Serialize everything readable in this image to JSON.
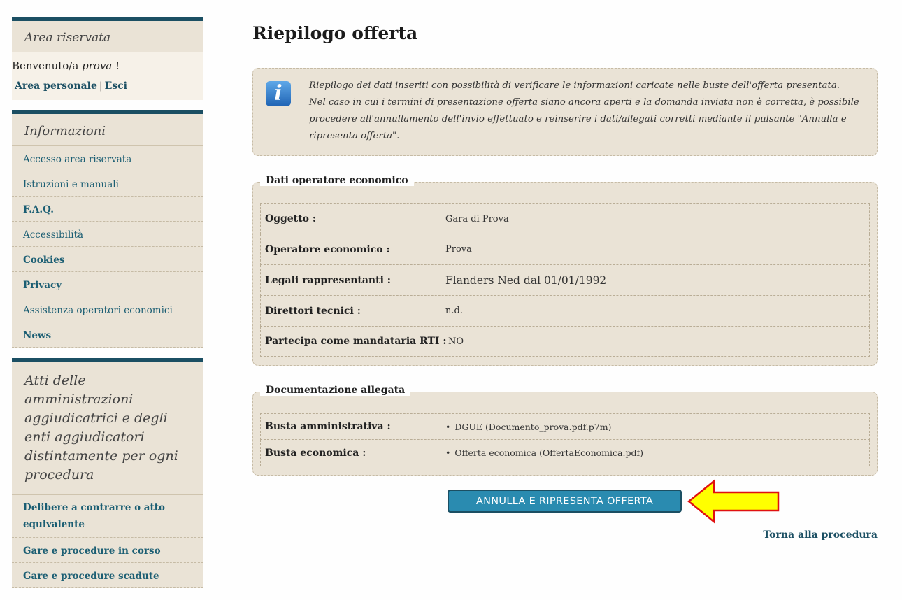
{
  "sidebar": {
    "reserved": {
      "title": "Area riservata",
      "welcome_prefix": "Benvenuto/a ",
      "username": "prova",
      "welcome_suffix": " !",
      "personal_area": "Area personale",
      "separator": "|",
      "logout": "Esci"
    },
    "info": {
      "title": "Informazioni",
      "items": [
        {
          "label": "Accesso area riservata"
        },
        {
          "label": "Istruzioni e manuali"
        },
        {
          "label": "F.A.Q."
        },
        {
          "label": "Accessibilità"
        },
        {
          "label": "Cookies"
        },
        {
          "label": "Privacy"
        },
        {
          "label": "Assistenza operatori economici"
        },
        {
          "label": "News"
        }
      ]
    },
    "acts": {
      "title": "Atti delle amministrazioni aggiudicatrici e degli enti aggiudicatori distintamente per ogni procedura",
      "items": [
        {
          "label": "Delibere a contrarre o atto equivalente"
        },
        {
          "label": "Gare e procedure in corso"
        },
        {
          "label": "Gare e procedure scadute"
        }
      ]
    }
  },
  "main": {
    "title": "Riepilogo offerta",
    "info_line1": "Riepilogo dei dati inseriti con possibilità di verificare le informazioni caricate nelle buste dell'offerta presentata.",
    "info_line2": "Nel caso in cui i termini di presentazione offerta siano ancora aperti e la domanda inviata non è corretta, è possibile procedere all'annullamento dell'invio effettuato e reinserire i dati/allegati corretti mediante il pulsante \"Annulla e ripresenta offerta\".",
    "operator_section": {
      "legend": "Dati operatore economico",
      "rows": [
        {
          "label": "Oggetto :",
          "value": "Gara di Prova"
        },
        {
          "label": "Operatore economico :",
          "value": "Prova"
        },
        {
          "label": "Legali rappresentanti :",
          "value": "Flanders Ned dal 01/01/1992"
        },
        {
          "label": "Direttori tecnici :",
          "value": "n.d."
        },
        {
          "label": "Partecipa come mandataria RTI :",
          "value": "NO"
        }
      ]
    },
    "docs_section": {
      "legend": "Documentazione allegata",
      "rows": [
        {
          "label": "Busta amministrativa :",
          "value": "DGUE  (Documento_prova.pdf.p7m)"
        },
        {
          "label": "Busta economica :",
          "value": "Offerta economica  (OffertaEconomica.pdf)"
        }
      ]
    },
    "action_button": "ANNULLA E RIPRESENTA OFFERTA",
    "back_link": "Torna alla procedura"
  },
  "colors": {
    "accent": "#1b4f63",
    "button": "#2a8bb0",
    "panel": "#eae3d6",
    "arrow_fill": "#ffff00",
    "arrow_stroke": "#e01010"
  },
  "icons": {
    "info": "info-icon",
    "arrow": "arrow-left-icon"
  }
}
